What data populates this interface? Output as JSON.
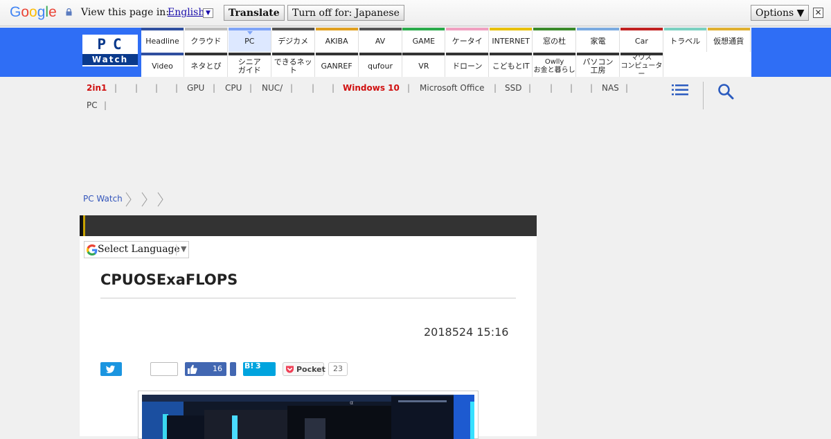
{
  "translate_bar": {
    "logo": [
      "G",
      "o",
      "o",
      "g",
      "l",
      "e"
    ],
    "logo_colors": [
      "#4285f4",
      "#ea4335",
      "#fbbc05",
      "#4285f4",
      "#34a853",
      "#ea4335"
    ],
    "prompt": "View this page in:",
    "language": "English",
    "translate_label": "Translate",
    "turn_off_label": "Turn off for: Japanese",
    "options_label": "Options ▼",
    "close_label": "✕"
  },
  "logo": {
    "pc": "PC",
    "watch": "Watch"
  },
  "nav": {
    "row1": [
      {
        "label": "Headline",
        "color": "#2f4f9f"
      },
      {
        "label": "クラウド",
        "color": "#bbbbbb"
      },
      {
        "label": "PC",
        "color": "#7fa4f7",
        "active": true
      },
      {
        "label": "デジカメ",
        "color": "#555555"
      },
      {
        "label": "AKIBA",
        "color": "#e0a020"
      },
      {
        "label": "AV",
        "color": "#555555"
      },
      {
        "label": "GAME",
        "color": "#2aaa4a"
      },
      {
        "label": "ケータイ",
        "color": "#f0a0c0"
      },
      {
        "label": "INTERNET",
        "color": "#e8c000"
      },
      {
        "label": "窓の杜",
        "color": "#3a8a2a"
      },
      {
        "label": "家電",
        "color": "#7aaae0"
      },
      {
        "label": "Car",
        "color": "#c02020"
      },
      {
        "label": "トラベル",
        "color": "#7ad0c0"
      },
      {
        "label": "仮想通貨",
        "color": "#e0b030"
      }
    ],
    "row2": [
      {
        "label": "Video",
        "color": "#2f4f9f"
      },
      {
        "label": "ネタとぴ",
        "color": "#333333"
      },
      {
        "label": "シニア\nガイド",
        "color": "#333333"
      },
      {
        "label": "できるネット",
        "color": "#333333"
      },
      {
        "label": "GANREF",
        "color": "#333333"
      },
      {
        "label": "qufour",
        "color": "#333333"
      },
      {
        "label": "VR",
        "color": "#333333"
      },
      {
        "label": "ドローン",
        "color": "#333333"
      },
      {
        "label": "こどもとIT",
        "color": "#333333"
      },
      {
        "label": "Owlly\nお金と暮らし",
        "color": "#333333"
      },
      {
        "label": "パソコン\n工房",
        "color": "#333333"
      },
      {
        "label": "マウス\nコンピューター",
        "color": "#333333"
      }
    ]
  },
  "tags": {
    "row1": [
      {
        "label": "2in1",
        "red": true
      },
      {
        "label": ""
      },
      {
        "label": ""
      },
      {
        "label": ""
      },
      {
        "label": "GPU"
      },
      {
        "label": "CPU"
      },
      {
        "label": "NUC/"
      },
      {
        "label": ""
      },
      {
        "label": ""
      },
      {
        "label": "Windows 10",
        "red": true
      },
      {
        "label": "Microsoft Office"
      },
      {
        "label": "SSD"
      },
      {
        "label": ""
      },
      {
        "label": ""
      },
      {
        "label": ""
      },
      {
        "label": "NAS"
      }
    ],
    "row2": [
      {
        "label": "PC"
      }
    ]
  },
  "breadcrumb": {
    "home": "PC Watch"
  },
  "select_language": "Select Language",
  "article": {
    "title": "CPUOSExaFLOPS",
    "date": "2018524 15:16"
  },
  "social": {
    "facebook_count": "16",
    "hatena_label": "B!",
    "hatena_count": "3",
    "pocket_label": "Pocket",
    "pocket_count": "23"
  }
}
